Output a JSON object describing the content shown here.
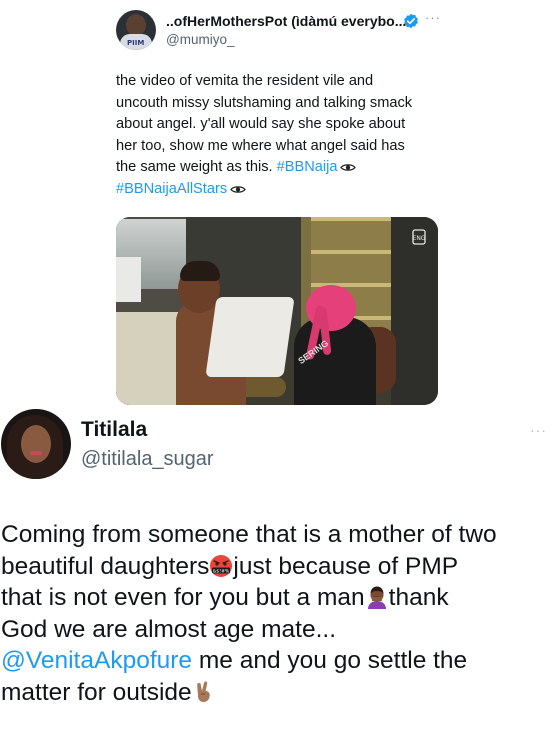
{
  "quoted_tweet": {
    "display_name": "..ofHerMothersPot (ìdàmú everybo...",
    "handle": "@mumiyo_",
    "verified": true,
    "more_label": "···",
    "avatar_shirt_text": "PIIM",
    "text_lines": [
      "the video of vemita the resident vile and",
      "uncouth missy slutshaming and talking smack",
      "about angel. y'all would say she spoke about",
      "her too, show me where what angel said has",
      "the same weight as this."
    ],
    "hashtag_1": "#BBNaija",
    "hashtag_2": "#BBNaijaAllStars",
    "media_watermark": "ENG",
    "media_shirt_text": "SERING"
  },
  "reply_tweet": {
    "display_name": "Titilala",
    "handle": "@titilala_sugar",
    "more_label": "···",
    "lines": {
      "l1": "Coming from someone that is a mother of two",
      "l2a": "beautiful daughters",
      "l2b": "just because of PMP",
      "l3a": "that is not even for you but a man",
      "l3b": "thank",
      "l4": "God we are almost age mate...",
      "l5_mention": "@VenitaAkpofure",
      "l5_rest": " me and you go settle the",
      "l6": "matter for outside"
    },
    "emoji_1_text": "&$!#%"
  },
  "colors": {
    "link": "#1d9bf0",
    "verified": "#1d9bf0",
    "secondary_text": "#536471",
    "primary_text": "#0f1419"
  },
  "icons": [
    "verified-badge-icon",
    "eye-emoji-icon",
    "swearing-face-emoji-icon",
    "person-facepalm-emoji-icon",
    "victory-hand-emoji-icon",
    "more-dots-icon"
  ]
}
